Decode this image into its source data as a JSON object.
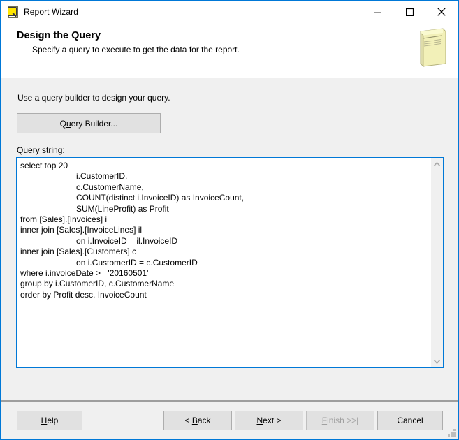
{
  "window": {
    "title": "Report Wizard",
    "icon": "report-wizard-icon",
    "border_color": "#0078d7",
    "controls": {
      "minimize": "minimize-icon",
      "maximize": "maximize-icon",
      "close": "close-icon"
    }
  },
  "banner": {
    "title": "Design the Query",
    "subtitle": "Specify a query to execute to get the data for the report.",
    "icon": "report-document-icon"
  },
  "body": {
    "hint": "Use a query builder to design your query.",
    "query_builder_button": "Query Builder...",
    "query_builder_button_prefix": "Q",
    "query_builder_button_accel": "u",
    "query_builder_button_suffix": "ery Builder...",
    "query_label_accel": "Q",
    "query_label_rest": "uery string:",
    "query_string": "select top 20\n\t\ti.CustomerID,\n\t\tc.CustomerName,\n\t\tCOUNT(distinct i.InvoiceID) as InvoiceCount,\n\t\tSUM(LineProfit) as Profit\nfrom [Sales].[Invoices] i\ninner join [Sales].[InvoiceLines] il\n\t\ton i.InvoiceID = il.InvoiceID\ninner join [Sales].[Customers] c\n\t\ton i.CustomerID = c.CustomerID\nwhere i.invoiceDate >= '20160501'\ngroup by i.CustomerID, c.CustomerName\norder by Profit desc, InvoiceCount",
    "scroll_up_icon": "chevron-up-icon",
    "scroll_down_icon": "chevron-down-icon"
  },
  "footer": {
    "help": {
      "accel": "H",
      "rest": "elp",
      "pre": "",
      "enabled": true
    },
    "back": {
      "accel": "B",
      "rest": "ack",
      "pre": "< ",
      "enabled": true
    },
    "next": {
      "accel": "N",
      "rest": "ext >",
      "pre": "",
      "enabled": true
    },
    "finish": {
      "accel": "F",
      "rest": "inish >>|",
      "pre": "",
      "enabled": false
    },
    "cancel": {
      "accel": "",
      "rest": "Cancel",
      "pre": "",
      "enabled": true
    },
    "resize_grip": "resize-grip-icon"
  }
}
